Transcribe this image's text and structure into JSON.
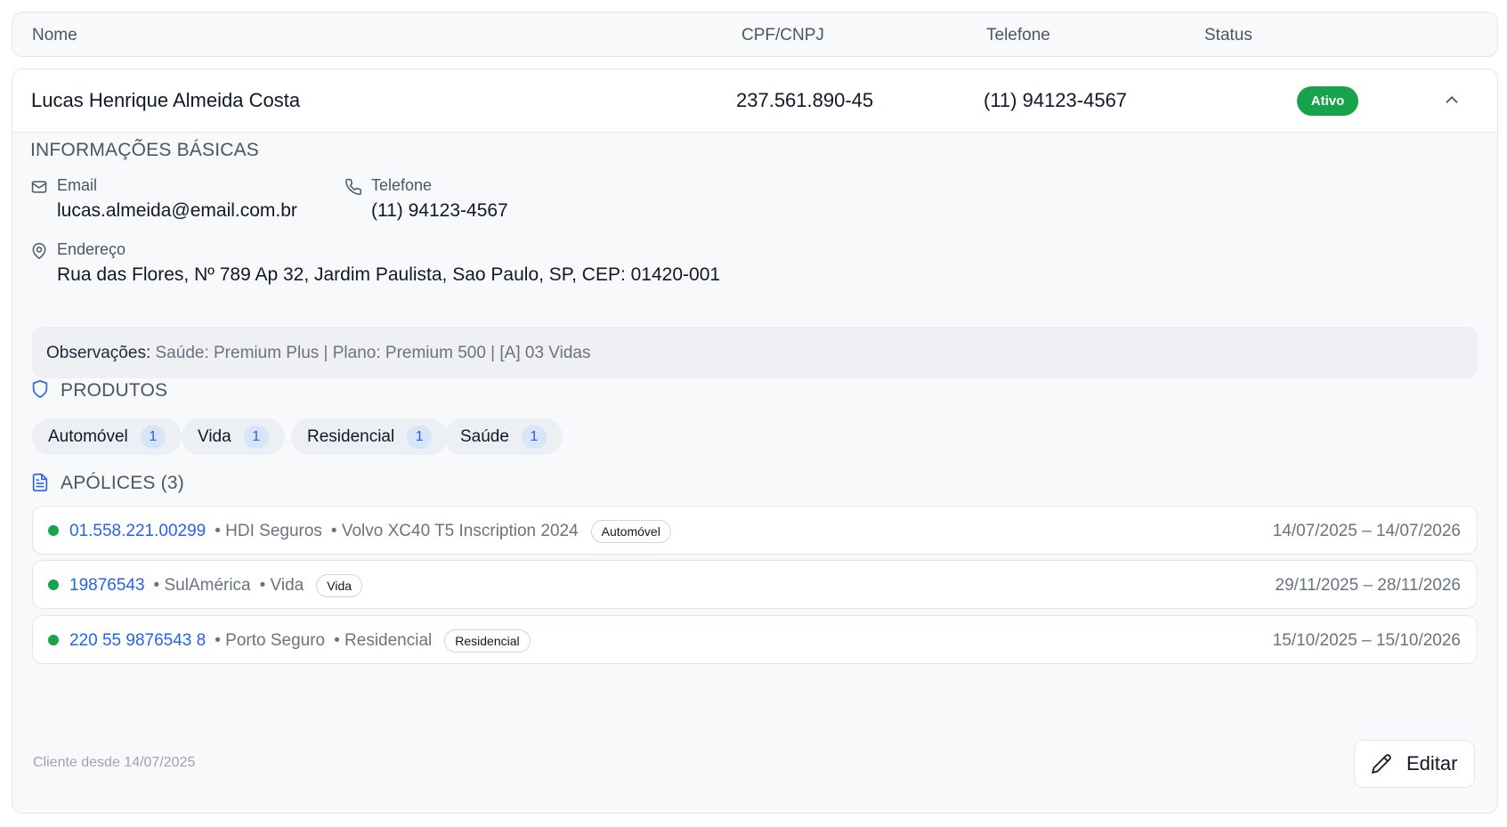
{
  "table_header": {
    "name": "Nome",
    "doc": "CPF/CNPJ",
    "phone": "Telefone",
    "status": "Status"
  },
  "client": {
    "name": "Lucas Henrique Almeida Costa",
    "doc": "237.561.890-45",
    "phone": "(11) 94123-4567",
    "status": "Ativo",
    "status_color": "#16a34a"
  },
  "basic_info": {
    "title": "INFORMAÇÕES BÁSICAS",
    "email_label": "Email",
    "email": "lucas.almeida@email.com.br",
    "phone_label": "Telefone",
    "phone": "(11) 94123-4567",
    "address_label": "Endereço",
    "address": "Rua das Flores, Nº 789 Ap 32, Jardim Paulista, Sao Paulo, SP, CEP: 01420-001",
    "obs_label": "Observações:",
    "obs_text": " Saúde: Premium Plus | Plano: Premium 500 | [A] 03 Vidas"
  },
  "products": {
    "title": "PRODUTOS",
    "items": [
      {
        "label": "Automóvel",
        "count": "1"
      },
      {
        "label": "Vida",
        "count": "1"
      },
      {
        "label": "Residencial",
        "count": "1"
      },
      {
        "label": "Saúde",
        "count": "1"
      }
    ]
  },
  "policies": {
    "title": "APÓLICES (3)",
    "items": [
      {
        "number": "01.558.221.00299",
        "insurer": "• HDI Seguros",
        "desc": "• Volvo XC40 T5 Inscription 2024",
        "tag": "Automóvel",
        "dates": "14/07/2025 – 14/07/2026"
      },
      {
        "number": "19876543",
        "insurer": "• SulAmérica",
        "desc": "• Vida",
        "tag": "Vida",
        "dates": "29/11/2025 – 28/11/2026"
      },
      {
        "number": "220 55 9876543 8",
        "insurer": "• Porto Seguro",
        "desc": "• Residencial",
        "tag": "Residencial",
        "dates": "15/10/2025 – 15/10/2026"
      }
    ]
  },
  "footer": {
    "since": "Cliente desde 14/07/2025",
    "edit_label": "Editar"
  },
  "icons": {
    "chevron": "chevron-up-icon",
    "email": "mail-icon",
    "phone": "phone-icon",
    "address": "map-pin-icon",
    "products": "shield-icon",
    "policies": "file-text-icon",
    "edit": "pencil-icon"
  },
  "colors": {
    "accent": "#2563eb",
    "active": "#16a34a"
  }
}
